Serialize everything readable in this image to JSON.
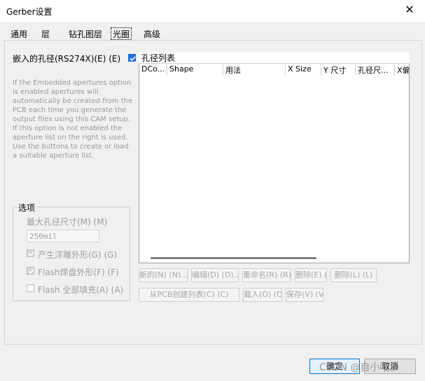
{
  "window": {
    "title": "Gerber设置",
    "close_glyph": "✕"
  },
  "tabs": [
    {
      "label": "通用",
      "active": false
    },
    {
      "label": "层",
      "active": false
    },
    {
      "label": "钻孔图层",
      "active": false
    },
    {
      "label": "光圈",
      "active": true
    },
    {
      "label": "高级",
      "active": false
    }
  ],
  "embed": {
    "label": "嵌入的孔径(RS274X)(E) (E)",
    "checked": true
  },
  "help_text": "If the Embedded apertures option is enabled apertures will automatically be created from the PCB each time you generate the output files using this CAM setup. If this option is not enabled the aperture list on the right is used. Use the buttons to create or load a suitable aperture list.",
  "options": {
    "title": "选项",
    "max_size_label": "最大孔径尺寸(M) (M)",
    "max_size_value": "250mil",
    "relief_label": "产生浮雕外形(G) (G)",
    "flash_pad_label": "Flash焊盘外形(F) (F)",
    "flash_fill_label": "Flash 全部填充(A) (A)"
  },
  "list": {
    "title": "孔径列表",
    "columns": [
      "DCo...",
      "Shape",
      "用法",
      "X Size",
      "Y 尺寸",
      "孔径尺...",
      "X偏"
    ]
  },
  "buttons": {
    "new": "新的(N) (N)...",
    "edit": "编辑(D) (D)...",
    "rename": "重命名(R) (R)...",
    "delete": "删除(E) (E)",
    "remove": "删除(L) (L)",
    "create_from_pcb": "从PCB创建列表(C) (C)",
    "load": "载入(O) (O)",
    "save": "保存(V) (V)..."
  },
  "footer": {
    "ok": "确定",
    "cancel": "取消"
  },
  "watermark": "CSDN @自小吃多",
  "colors": {
    "accent": "#1e6fd9",
    "ok_border": "#0078d4"
  }
}
